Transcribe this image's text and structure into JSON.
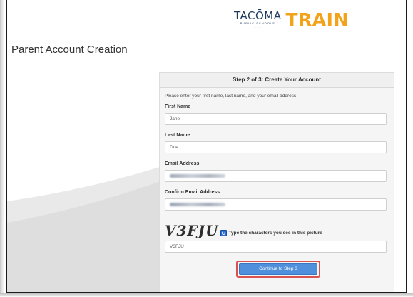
{
  "brand": {
    "tacoma": "TACŌMA",
    "public_schools": "PUBLIC SCHOOLS",
    "tagline": "· · · · · · · ·",
    "train": "TRAIN",
    "colors": {
      "train": "#f2a31a",
      "tacoma": "#1f3a5f"
    }
  },
  "page": {
    "title": "Parent Account Creation"
  },
  "form": {
    "step_title": "Step 2 of 3: Create Your Account",
    "instructions": "Please enter your first name, last name, and your email address",
    "first_name": {
      "label": "First Name",
      "value": "Jane"
    },
    "last_name": {
      "label": "Last Name",
      "value": "Doe"
    },
    "email": {
      "label": "Email Address",
      "value": ""
    },
    "confirm_email": {
      "label": "Confirm Email Address",
      "value": ""
    },
    "captcha": {
      "image_text": "V3FJU",
      "label": "Type the characters you see in this picture",
      "value": "V3FJU",
      "refresh_icon": "refresh-icon"
    },
    "continue_label": "Continue to Step 3",
    "colors": {
      "button": "#4f8fdb",
      "highlight": "#d8534f"
    }
  }
}
